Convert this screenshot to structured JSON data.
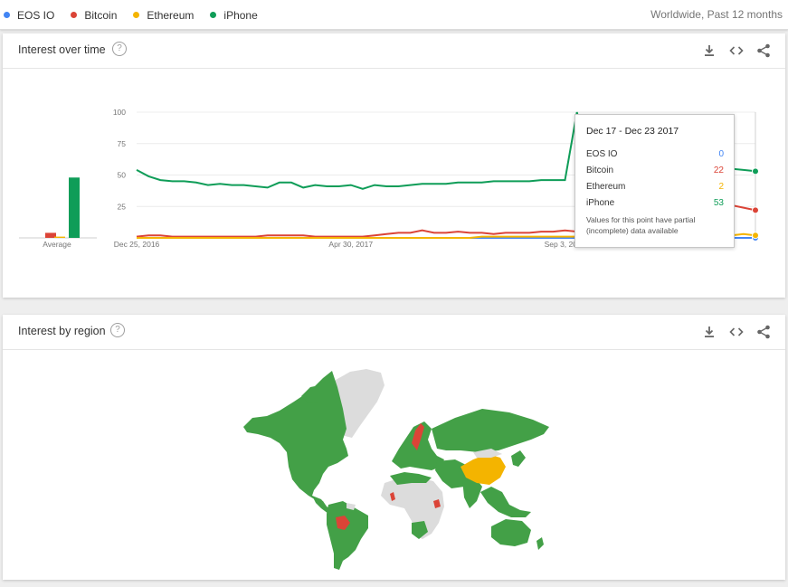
{
  "topbar": {
    "terms": [
      {
        "label": "EOS IO",
        "color": "#4285f4"
      },
      {
        "label": "Bitcoin",
        "color": "#db4437"
      },
      {
        "label": "Ethereum",
        "color": "#f4b400"
      },
      {
        "label": "iPhone",
        "color": "#0f9d58"
      }
    ],
    "scope": "Worldwide, Past 12 months"
  },
  "interest_over_time": {
    "title": "Interest over time",
    "help_icon": "help-circle-icon",
    "actions": [
      "download-icon",
      "embed-code-icon",
      "share-icon"
    ],
    "average_label": "Average",
    "tooltip": {
      "date": "Dec 17 - Dec 23 2017",
      "rows": [
        {
          "label": "EOS IO",
          "value": "0",
          "color": "#4285f4"
        },
        {
          "label": "Bitcoin",
          "value": "22",
          "color": "#db4437"
        },
        {
          "label": "Ethereum",
          "value": "2",
          "color": "#f4b400"
        },
        {
          "label": "iPhone",
          "value": "53",
          "color": "#0f9d58"
        }
      ],
      "note": "Values for this point have partial (incomplete) data available"
    }
  },
  "interest_by_region": {
    "title": "Interest by region",
    "help_icon": "help-circle-icon",
    "actions": [
      "download-icon",
      "embed-code-icon",
      "share-icon"
    ]
  },
  "chart_data": {
    "type": "line",
    "ylim": [
      0,
      100
    ],
    "yticks": [
      25,
      50,
      75,
      100
    ],
    "x_tick_labels": [
      "Dec 25, 2016",
      "Apr 30, 2017",
      "Sep 3, 2017"
    ],
    "x_tick_index": [
      0,
      18,
      36
    ],
    "series": [
      {
        "name": "EOS IO",
        "color": "#4285f4",
        "average": 0,
        "values": [
          0,
          0,
          0,
          0,
          0,
          0,
          0,
          0,
          0,
          0,
          0,
          0,
          0,
          0,
          0,
          0,
          0,
          0,
          0,
          0,
          0,
          0,
          0,
          0,
          0,
          0,
          0,
          0,
          0,
          0,
          0,
          0,
          0,
          0,
          0,
          0,
          0,
          0,
          0,
          0,
          0,
          0,
          0,
          0,
          0,
          0,
          0,
          0,
          0,
          0,
          0,
          0,
          0
        ]
      },
      {
        "name": "Bitcoin",
        "color": "#db4437",
        "average": 4,
        "values": [
          1,
          2,
          2,
          1,
          1,
          1,
          1,
          1,
          1,
          1,
          1,
          2,
          2,
          2,
          2,
          1,
          1,
          1,
          1,
          1,
          2,
          3,
          4,
          4,
          6,
          4,
          4,
          5,
          4,
          4,
          3,
          4,
          4,
          4,
          5,
          5,
          6,
          5,
          5,
          6,
          5,
          6,
          7,
          8,
          9,
          10,
          12,
          14,
          17,
          20,
          26,
          24,
          22
        ]
      },
      {
        "name": "Ethereum",
        "color": "#f4b400",
        "average": 1,
        "values": [
          0,
          0,
          0,
          0,
          0,
          0,
          0,
          0,
          0,
          0,
          0,
          0,
          0,
          0,
          0,
          0,
          0,
          0,
          0,
          0,
          0,
          0,
          0,
          0,
          0,
          0,
          0,
          0,
          0,
          1,
          1,
          1,
          1,
          1,
          1,
          1,
          1,
          1,
          1,
          1,
          1,
          1,
          1,
          1,
          1,
          1,
          1,
          1,
          1,
          1,
          2,
          3,
          2
        ]
      },
      {
        "name": "iPhone",
        "color": "#0f9d58",
        "average": 48,
        "values": [
          54,
          49,
          46,
          45,
          45,
          44,
          42,
          43,
          42,
          42,
          41,
          40,
          44,
          44,
          40,
          42,
          41,
          41,
          42,
          39,
          42,
          41,
          41,
          42,
          43,
          43,
          43,
          44,
          44,
          44,
          45,
          45,
          45,
          45,
          46,
          46,
          46,
          100,
          60,
          55,
          52,
          50,
          52,
          54,
          60,
          59,
          55,
          57,
          56,
          56,
          55,
          54,
          53
        ]
      }
    ]
  }
}
